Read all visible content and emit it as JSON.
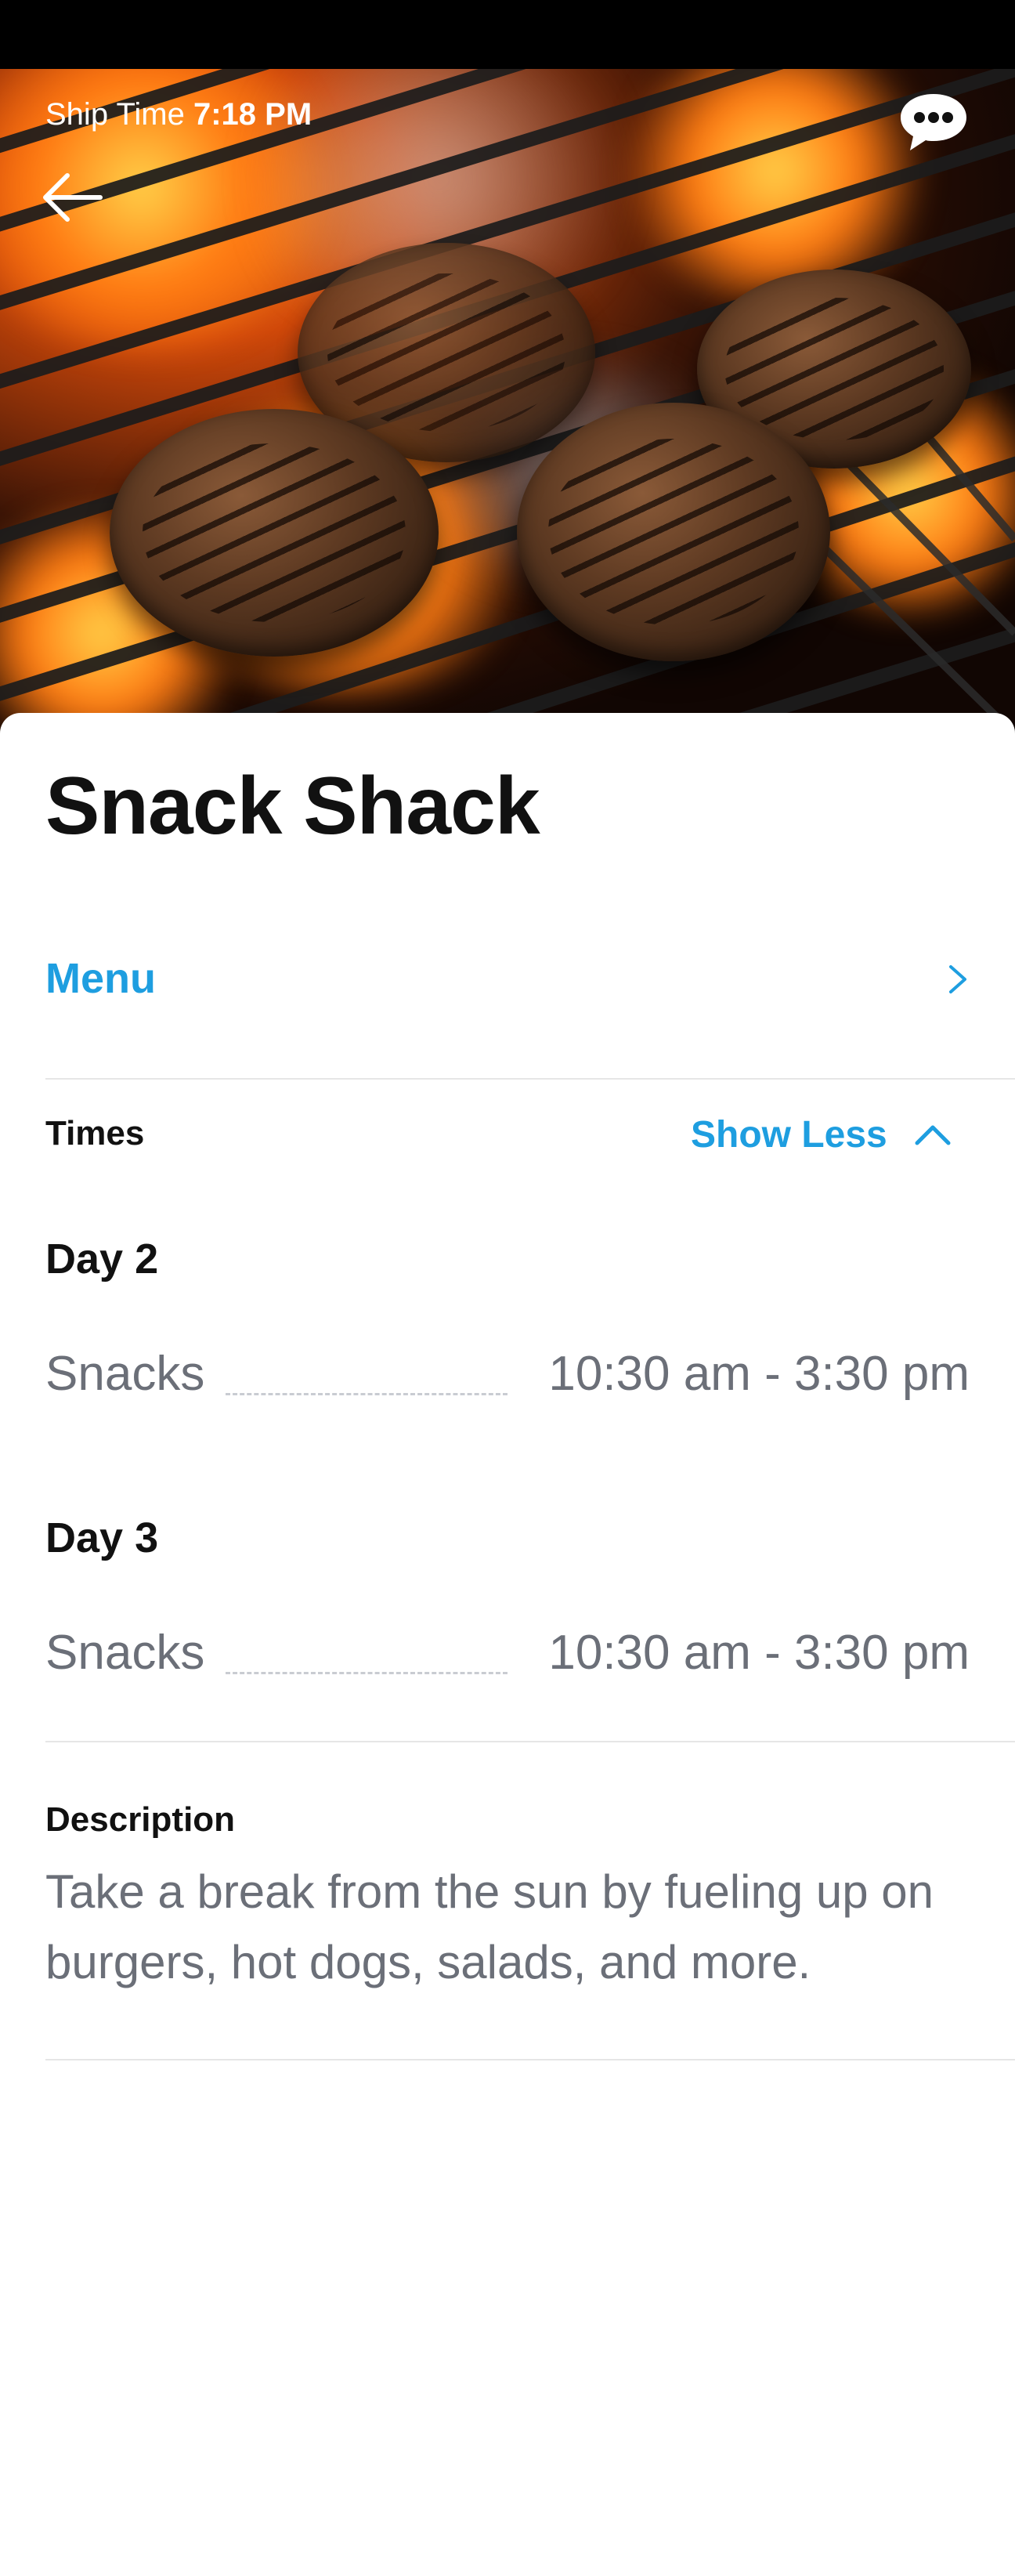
{
  "status": {
    "ship_time_label": "Ship Time",
    "ship_time_value": "7:18 PM"
  },
  "hero": {
    "image": "grilled-burger-patties-photo",
    "back_icon": "arrow-left-icon",
    "chat_icon": "chat-bubble-icon"
  },
  "venue": {
    "title": "Snack Shack"
  },
  "menu": {
    "label": "Menu",
    "icon": "chevron-right-icon"
  },
  "times": {
    "label": "Times",
    "toggle_label": "Show Less",
    "toggle_icon": "chevron-up-icon",
    "days": [
      {
        "day": "Day 2",
        "slots": [
          {
            "meal": "Snacks",
            "hours": "10:30 am - 3:30 pm"
          }
        ]
      },
      {
        "day": "Day 3",
        "slots": [
          {
            "meal": "Snacks",
            "hours": "10:30 am - 3:30 pm"
          }
        ]
      }
    ]
  },
  "description": {
    "label": "Description",
    "text": "Take a break from the sun by fueling up on burgers, hot dogs, salads, and more."
  },
  "colors": {
    "accent": "#1e9ee0",
    "muted_text": "#6b6f78",
    "primary_text": "#111111"
  }
}
